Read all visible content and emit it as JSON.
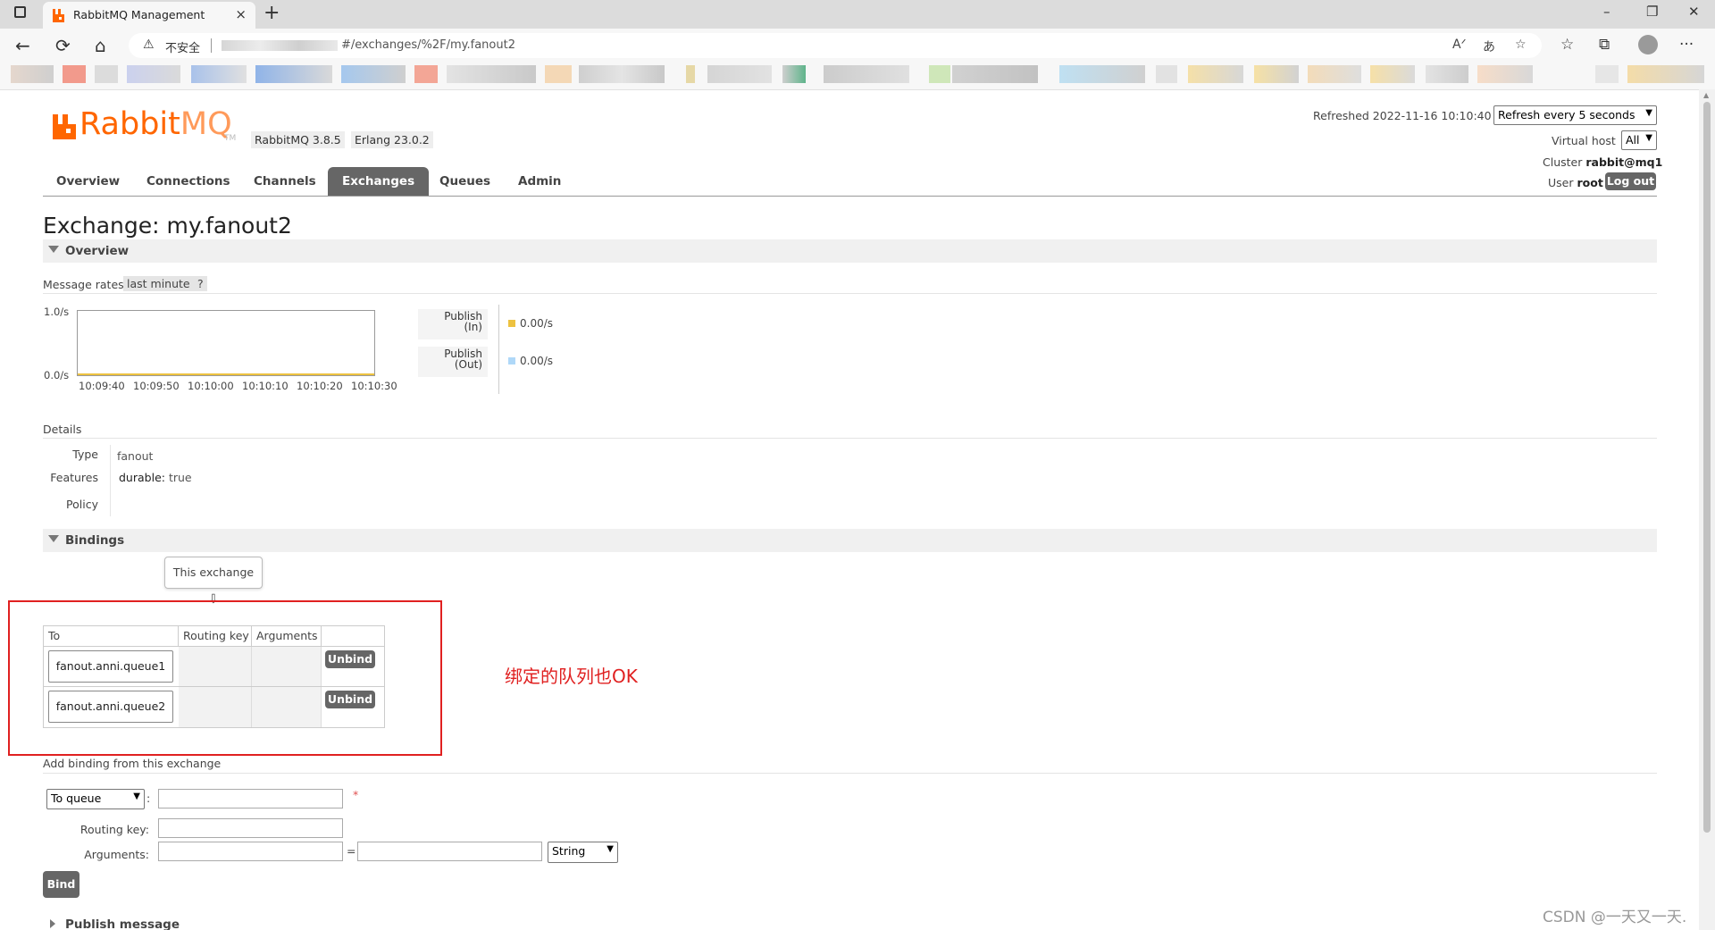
{
  "browser": {
    "tab_title": "RabbitMQ Management",
    "tab_close": "×",
    "new_tab": "+",
    "window_minimize": "–",
    "window_restore": "❐",
    "window_close": "✕",
    "security_label": "不安全",
    "url": "#/exchanges/%2F/my.fanout2",
    "back": "←",
    "reload": "⟳",
    "home": "⌂",
    "more": "···"
  },
  "header": {
    "logo_primary": "Rabbit",
    "logo_secondary": "MQ",
    "logo_tm": "TM",
    "version_badge": "RabbitMQ 3.8.5",
    "erlang_badge": "Erlang 23.0.2",
    "refreshed_text": "Refreshed 2022-11-16 10:10:40",
    "refresh_select": "Refresh every 5 seconds",
    "vhost_label": "Virtual host",
    "vhost_select": "All",
    "cluster_label": "Cluster",
    "cluster_value": "rabbit@mq1",
    "user_label": "User",
    "user_value": "root",
    "logout_label": "Log out"
  },
  "nav": {
    "tabs": [
      "Overview",
      "Connections",
      "Channels",
      "Exchanges",
      "Queues",
      "Admin"
    ],
    "active": "Exchanges"
  },
  "page": {
    "title_prefix": "Exchange:",
    "title_name": "my.fanout2"
  },
  "overview": {
    "section_label": "Overview",
    "message_rates_label": "Message rates",
    "range_pill": "last minute",
    "help_pill": "?",
    "chart_data": {
      "type": "line",
      "x": [
        "10:09:40",
        "10:09:50",
        "10:10:00",
        "10:10:10",
        "10:10:20",
        "10:10:30"
      ],
      "ylim": [
        0.0,
        1.0
      ],
      "y_tick_labels": [
        "1.0/s",
        "0.0/s"
      ],
      "series": [
        {
          "name": "Publish (In)",
          "values": [
            0,
            0,
            0,
            0,
            0,
            0
          ],
          "color": "#edc240",
          "rate": "0.00/s"
        },
        {
          "name": "Publish (Out)",
          "values": [
            0,
            0,
            0,
            0,
            0,
            0
          ],
          "color": "#afd8f8",
          "rate": "0.00/s"
        }
      ]
    },
    "legend": [
      {
        "line1": "Publish",
        "line2": "(In)",
        "value": "0.00/s",
        "color": "#edc240"
      },
      {
        "line1": "Publish",
        "line2": "(Out)",
        "value": "0.00/s",
        "color": "#afd8f8"
      }
    ]
  },
  "details": {
    "section_label": "Details",
    "type_label": "Type",
    "type_value": "fanout",
    "features_label": "Features",
    "features_key": "durable:",
    "features_value": "true",
    "policy_label": "Policy"
  },
  "bindings": {
    "section_label": "Bindings",
    "source_label": "This exchange",
    "arrow": "⇩",
    "columns": [
      "To",
      "Routing key",
      "Arguments",
      ""
    ],
    "rows": [
      {
        "to": "fanout.anni.queue1",
        "routing_key": "",
        "arguments": "",
        "action": "Unbind"
      },
      {
        "to": "fanout.anni.queue2",
        "routing_key": "",
        "arguments": "",
        "action": "Unbind"
      }
    ],
    "annotation": "绑定的队列也OK"
  },
  "add_binding": {
    "section_label": "Add binding from this exchange",
    "destination_select": "To queue",
    "destination_colon": ":",
    "required_mark": "*",
    "routing_key_label": "Routing key:",
    "arguments_label": "Arguments:",
    "equals": "=",
    "type_select": "String",
    "bind_label": "Bind"
  },
  "publish": {
    "section_label": "Publish message"
  },
  "watermark": "CSDN @一天又一天."
}
